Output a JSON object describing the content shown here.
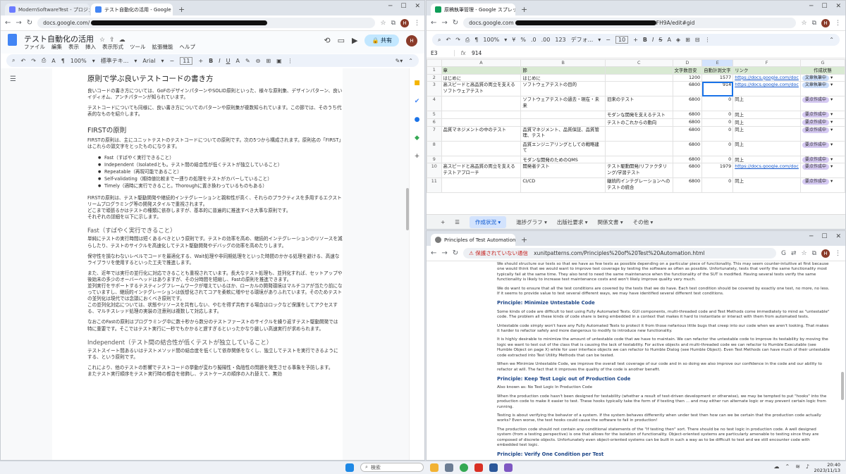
{
  "left_window": {
    "tabs": [
      {
        "label": "ModernSoftwareTest - プロジェク"
      },
      {
        "label": "テスト自動化の活用 - Google ドキ"
      }
    ],
    "url": "docs.google.com/",
    "doc_title": "テスト自動化の活用",
    "menu": [
      "ファイル",
      "編集",
      "表示",
      "挿入",
      "表示形式",
      "ツール",
      "拡張機能",
      "ヘルプ"
    ],
    "share_label": "共有",
    "avatar_letter": "H",
    "toolbar": {
      "zoom": "100%",
      "style": "標準テキ...",
      "font": "Arial",
      "size": "11"
    },
    "content": {
      "h1": "原則で学ぶ良いテストコードの書き方",
      "intro": [
        "良いコードの書き方については、GoFのデザインパターンやSOLID原則といった、様々な原則集、デザインパターン、良いイディオム、アンチパターンが知られています。",
        "テストコードについても同様に、良い書き方についてのパターンや原則集が複数知られています。この節では、そのうち代表的なものを紹介します。"
      ],
      "first_heading": "FIRSTの原則",
      "first_intro": "FIRSTの原則は、主にユニットテストのテストコードについての原則です。次の5つから構成されます。原則名の「FIRST」はこれらの頭文字をとったものになります。",
      "bullets": [
        "Fast（すばやく実行できること）",
        "Independent（Isolatedとも。テスト間の結合性が低くテストが独立していること）",
        "Repeatable（再現可能であること）",
        "Self-validating（期待値比較まで一連りの処理をテストがカバーしていること）",
        "Timely（適時に実行できること。Thoroughに置き換わっているものもある）"
      ],
      "first_body_1": "FIRSTの原則は、テスト駆動開発や継続的インテグレーションと親和性が高く、それらのプラクティスを多用するエクストリームプログラミング等の開発スタイルで重視されます。",
      "first_body_2": "どこまで頑張るかはテストの種類に依存しますが、基本的に普遍的に推進すべき大事な原則です。",
      "first_body_3": "それぞれの詳細を以下に示します。",
      "fast_heading": "Fast（すばやく実行できること）",
      "fast_p1": "単純にテストの実行時間は短くあるべきという原則です。テストの効率を高め、継続的インテグレーションのリソースを減らしたり、テストのサイクルを高速化してテスト駆動開発やデバッグの効率を高めたりします。",
      "fast_p2": "保守性を損なわないレベルでコードを最適化する、Wait処理や非同期処理をといった時間のかかる処理を避ける、高速なライブラリを使用するといった工夫で推進します。",
      "fast_p3": "また、近年では実行の並行化に対応できることも重視されています。長大なテスト処理も、並列化すれば、セットアップや後始末の多少のオーバーヘッドはありますが、その分時間を短縮し、Fastの原則を推進できます。",
      "fast_p4": "並列実行をサポートするテスティングフレームワークが増えているほか、ローカルの開発環境はマルチコアが当たり前になっていますし、継続的インテグレーションは仮想化されてコアを柔軟に増やせる環境がありふれています。そのためテストの並列化は現代では念頭におくべき原則です。",
      "fast_p5": "この並列化対応については、状態やリソースを共有しない、やむを得ず共有する場合はロックなど保護をしてアクセスする、マルチスレッド処理の実装の注意則は複数して対応します。",
      "fast_p6": "なおこのFastの原則はプログラミング中に数十秒から数分のテストファーストのサイクルを繰り返すテスト駆動開発では特に重要です。そこではテスト実行に一秒でもかかると遅すぎるといったかなり厳しい高速実行が求められます。",
      "indep_heading": "Independent（テスト間の結合性が低くテストが独立していること）",
      "indep_p1": "テストスイート間あるいはテストメソッド間の結合度を低くして依存関係をなくし、独立してテストを実行できるようにする、という原則です。",
      "indep_p2": "これにより、他のテストの影響でテストコードの挙動が変わり擬陽性・偽陰性の問題を発生させる事象を予防します。",
      "indep_p3": "またテスト実行順序をテスト実行時の都合を修飾し、テストケースの順序の入れ替えて、無効"
    }
  },
  "sheet_window": {
    "tab_label": "原稿執筆管理 - Google スプレッ",
    "url": "docs.google.com",
    "url_tail": "FH9A/edit#gid",
    "avatar_letter": "H",
    "toolbar": {
      "zoom": "100%",
      "currency": "¥",
      "percent": "%",
      "dec1": ".0",
      "dec2": ".00",
      "fmt": "123",
      "font": "デフォ...",
      "size": "10"
    },
    "cell_ref": "E3",
    "formula_value": "914",
    "columns": [
      "A",
      "B",
      "C",
      "D",
      "E",
      "F",
      "G"
    ],
    "headers": [
      "章",
      "節",
      "",
      "文字数目安",
      "自動計測文字",
      "リンク",
      "作成状態"
    ],
    "rows": [
      {
        "n": "2",
        "a": "はじめに",
        "b": "はじめに",
        "c": "",
        "d": "1200",
        "e": "1577",
        "f": "https://docs.google.com/doc",
        "g": "文章執筆中"
      },
      {
        "n": "3",
        "a": "高スピードと高品質の両立を支えるソフトウェアテスト",
        "b": "ソフトウェアテストの目的",
        "c": "",
        "d": "6800",
        "e": "914",
        "f": "https://docs.google.com/doc",
        "g": "文章執筆中"
      },
      {
        "n": "4",
        "a": "",
        "b": "ソフトウェアテストの過去・現在・未来",
        "c": "旧来のテスト",
        "d": "6800",
        "e": "0",
        "f": "同上",
        "g": "要点作成中"
      },
      {
        "n": "5",
        "a": "",
        "b": "",
        "c": "モダンな開発を支えるテスト",
        "d": "6800",
        "e": "0",
        "f": "同上",
        "g": "要点作成中"
      },
      {
        "n": "6",
        "a": "",
        "b": "",
        "c": "テストのこれからの動向",
        "d": "6800",
        "e": "0",
        "f": "同上",
        "g": "要点作成中"
      },
      {
        "n": "7",
        "a": "品質マネジメントの中のテスト",
        "b": "品質マネジメント、品質保証、品質管理、テスト",
        "c": "",
        "d": "6800",
        "e": "0",
        "f": "同上",
        "g": "要点作成中"
      },
      {
        "n": "8",
        "a": "",
        "b": "品質エンジニアリングとしての戦略建て",
        "c": "",
        "d": "6800",
        "e": "0",
        "f": "同上",
        "g": "要点作成中"
      },
      {
        "n": "9",
        "a": "",
        "b": "モダンな開発のためのQMS",
        "c": "",
        "d": "6800",
        "e": "0",
        "f": "同上",
        "g": "要点作成中"
      },
      {
        "n": "10",
        "a": "高スピードと高品質の両立を支えるテストアプローチ",
        "b": "開発者テスト",
        "c": "テスト駆動開発/リファクタリング/学習テスト",
        "d": "6800",
        "e": "1979",
        "f": "https://docs.google.com/doc",
        "g": "要点作成中"
      },
      {
        "n": "11",
        "a": "",
        "b": "CI/CD",
        "c": "継続的インテグレーションへのテストの統合",
        "d": "6800",
        "e": "0",
        "f": "同上",
        "g": "要点作成中"
      }
    ],
    "sheet_tabs": [
      "作成状況",
      "進捗グラフ",
      "出版社要求",
      "関係文書",
      "その他"
    ]
  },
  "browser_window": {
    "tab_label": "Principles of Test Automation at",
    "security": "保護されていない通信",
    "url": "xunitpatterns.com/Principles%20of%20Test%20Automation.html",
    "avatar_letter": "H",
    "article": {
      "p0": "We should structure our tests so that we have as few tests as possible depending on a particular piece of functionality. This may seem counter-intuitive at first because one would think that we would want to improve test coverage by testing the software as often as possible. Unfortunately, tests that verify the same functionality most typically fail at the same time. They also tend to need the same maintenance when the functionality of the SUT is modified. Having several tests verify the same functionality is likely to increase test maintenance costs and won't likely improve quality very much.",
      "p1": "We do want to ensure that all the test conditions are covered by the tests that we do have. Each test condition should be covered by exactly one test, no more, no less. If it seems to provide value to test several different ways, we may have identified several different test conditions.",
      "h1": "Principle: Minimize Untestable Code",
      "p2": "Some kinds of code are difficult to test using Fully Automated Tests. GUI components, multi-threaded code and Test Methods come immediately to mind as \"untestable\" code. The problem all these kinds of code share is being embedded in a context that makes it hard to instantiate or interact with them from automated tests.",
      "p3": "Untestable code simply won't have any Fully Automated Tests to protect it from those nefarious little bugs that creep into our code when we aren't looking. That makes it harder to refactor safely and more dangerous to modify to introduce new functionality.",
      "p4": "It is highly desirable to minimize the amount of untestable code that we have to maintain. We can refactor the untestable code to improve its testability by moving the logic we want to test out of the class that is causing the lack of testability. For active objects and multi-threaded code we can refactor to Humble Executable (see Humble Object on page X) while for user interface objects we can refactor to Humble Dialog (see Humble Object). Even Test Methods can have much of their untestable code extracted into Test Utility Methods that can be tested.",
      "p5": "When we Minimize Untestable Code, we improve the overall test coverage of our code and in so doing we also improve our confidence in the code and our ability to refactor at will. The fact that it improves the quality of the code is another benefit.",
      "h2": "Principle: Keep Test Logic out of Production Code",
      "aka": "Also known as: No Test Logic In Production Code",
      "p6": "When the production code hasn't been designed for testability (whether a result of test-driven development or otherwise), we may be tempted to put \"hooks\" into the production code to make it easier to test. These hooks typically take the form of if testing then ... and may either run alternate logic or may prevent certain logic from running.",
      "p7": "Testing is about verifying the behavior of a system. If the system behaves differently when under test then how can we be certain that the production code actually works? Even worse, the test hooks could cause the software to fail in production!",
      "p8": "The production code should not contain any conditional statements of the \"if testing then\" sort. There should be no test logic in production code. A well designed system (from a testing perspective) is one that allows for the isolation of functionality. Object-oriented systems are particularly amenable to testing since they are composed of discrete objects. Unfortunately even object-oriented systems can be built in such a way as to be difficult to test and we still encounter code with embedded test logic.",
      "h3": "Principle: Verify One Condition per Test"
    }
  },
  "taskbar": {
    "search_label": "検索",
    "time": "20:40",
    "date": "2023/11/13"
  },
  "colors": {
    "sheet_header_green": "#d9ead3",
    "chip_purple": "#d5c9f2",
    "chip_blue": "#c9dcf9",
    "link_blue": "#1155cc",
    "heading_blue": "#1c4587"
  }
}
